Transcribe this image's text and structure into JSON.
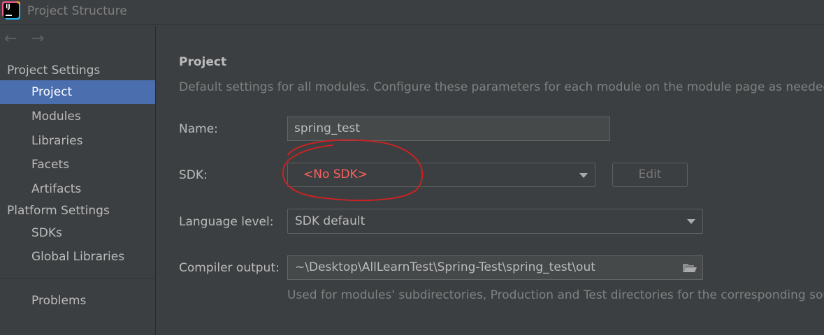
{
  "window": {
    "title": "Project Structure"
  },
  "nav": {
    "back_glyph": "←",
    "forward_glyph": "→"
  },
  "sidebar": {
    "project_settings": "Project Settings",
    "project_items": [
      {
        "label": "Project",
        "selected": true
      },
      {
        "label": "Modules"
      },
      {
        "label": "Libraries"
      },
      {
        "label": "Facets"
      },
      {
        "label": "Artifacts"
      }
    ],
    "platform_settings": "Platform Settings",
    "platform_items": [
      {
        "label": "SDKs"
      },
      {
        "label": "Global Libraries"
      }
    ],
    "problems": "Problems"
  },
  "main": {
    "heading": "Project",
    "description": "Default settings for all modules. Configure these parameters for each module on the module page as needed.",
    "name": {
      "label": "Name:",
      "value": "spring_test"
    },
    "sdk": {
      "label": "SDK:",
      "value": "<No SDK>",
      "edit_label": "Edit"
    },
    "language_level": {
      "label": "Language level:",
      "value": "SDK default"
    },
    "compiler_output": {
      "label": "Compiler output:",
      "value": "~\\Desktop\\AllLearnTest\\Spring-Test\\spring_test\\out",
      "hint": "Used for modules' subdirectories, Production and Test directories for the corresponding sources."
    }
  },
  "colors": {
    "selection": "#4b6eaf",
    "error_text": "#ff5f5f",
    "annotation": "#d42020",
    "background": "#3c3f41"
  }
}
